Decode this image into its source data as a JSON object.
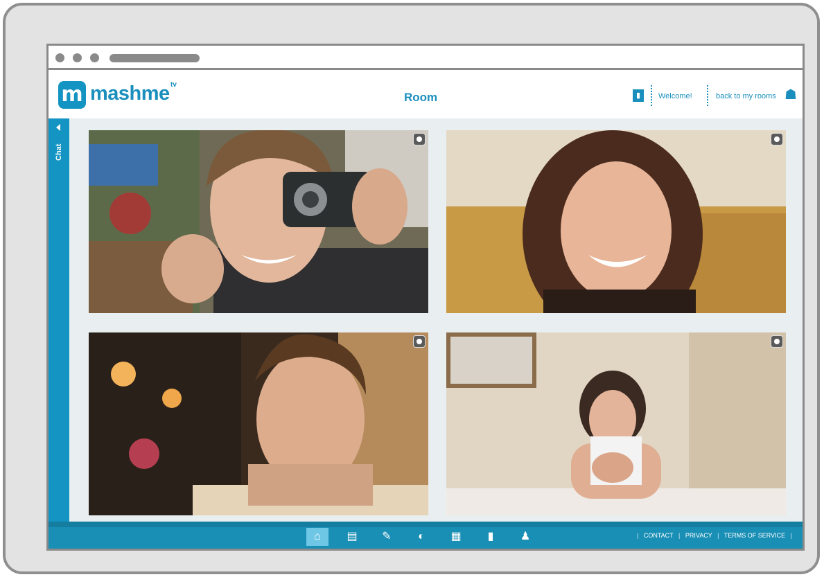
{
  "brand": {
    "name": "mashme",
    "suffix": "tv",
    "logo_letter": "m"
  },
  "header": {
    "title": "Room",
    "profile_icon": "profile-icon",
    "welcome": "Welcome!",
    "back_link": "back to my rooms",
    "rooms_icon": "rooms-icon"
  },
  "sidebar": {
    "chat_label": "Chat",
    "collapse_icon": "collapse-arrow-icon"
  },
  "video_tiles": [
    {
      "name": "participant-1",
      "options_icon": "tile-options-icon"
    },
    {
      "name": "participant-2",
      "options_icon": "tile-options-icon"
    },
    {
      "name": "participant-3",
      "options_icon": "tile-options-icon"
    },
    {
      "name": "participant-4",
      "options_icon": "tile-options-icon"
    }
  ],
  "toolbar": [
    {
      "icon": "home-icon",
      "glyph": "⌂",
      "active": true
    },
    {
      "icon": "document-icon",
      "glyph": "▤",
      "active": false
    },
    {
      "icon": "edit-icon",
      "glyph": "✎",
      "active": false
    },
    {
      "icon": "globe-icon",
      "glyph": "◐",
      "active": false
    },
    {
      "icon": "film-icon",
      "glyph": "▦",
      "active": false
    },
    {
      "icon": "stats-icon",
      "glyph": "▮",
      "active": false
    },
    {
      "icon": "users-icon",
      "glyph": "♟",
      "active": false
    }
  ],
  "footer": {
    "contact": "CONTACT",
    "privacy": "PRIVACY",
    "terms": "TERMS OF SERVICE"
  },
  "colors": {
    "brand_blue": "#1a8fbd",
    "footer_blue": "#1a8fb5",
    "active_tool": "#6fc7e6",
    "frame_gray": "#8a8a8a"
  }
}
